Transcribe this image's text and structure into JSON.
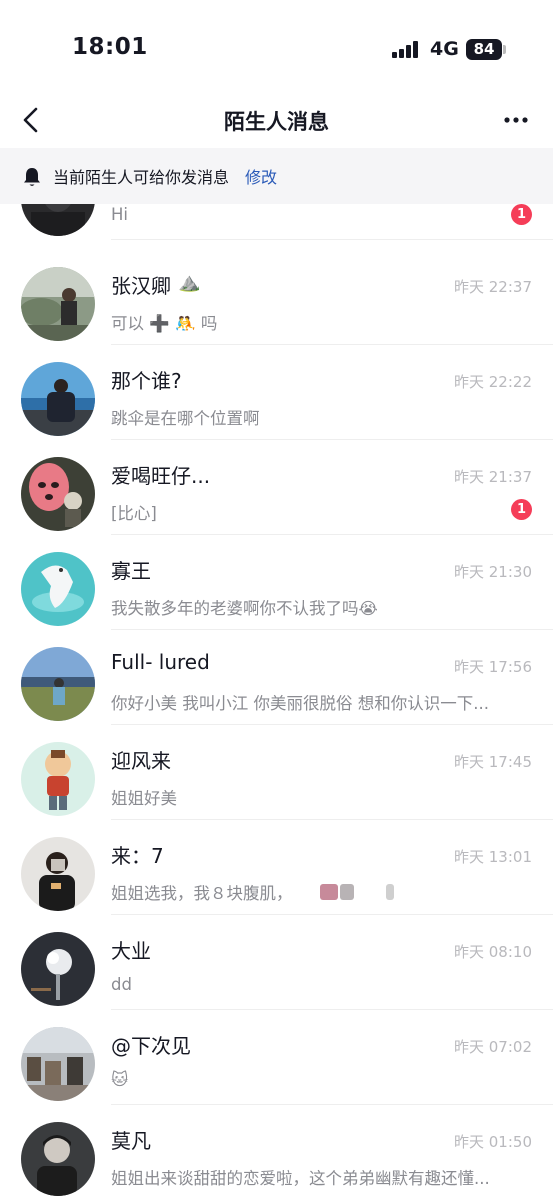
{
  "status_bar": {
    "time": "18:01",
    "network": "4G",
    "battery": "84"
  },
  "nav": {
    "title": "陌生人消息",
    "back_icon": "chevron-left-icon",
    "more_icon": "more-dots-icon"
  },
  "notice": {
    "text": "当前陌生人可给你发消息",
    "link": "修改",
    "icon": "bell-icon"
  },
  "conversations": [
    {
      "name": "",
      "message": "Hi",
      "time": "",
      "unread": "1"
    },
    {
      "name": "张汉卿",
      "name_suffix": "⛰️",
      "message": "可以 ➕ 🤼 吗",
      "time": "昨天 22:37",
      "unread": ""
    },
    {
      "name": "那个谁?",
      "message": "跳伞是在哪个位置啊",
      "time": "昨天 22:22",
      "unread": ""
    },
    {
      "name": "爱喝旺仔...",
      "message": "[比心]",
      "time": "昨天 21:37",
      "unread": "1"
    },
    {
      "name": "寡王",
      "message": "我失散多年的老婆啊你不认我了吗😭",
      "time": "昨天 21:30",
      "unread": ""
    },
    {
      "name": "Full- lured",
      "message": "你好小美 我叫小江 你美丽很脱俗 想和你认识一下...",
      "time": "昨天 17:56",
      "unread": ""
    },
    {
      "name": "迎风来",
      "message": "姐姐好美",
      "time": "昨天 17:45",
      "unread": ""
    },
    {
      "name": "来：7",
      "message": "姐姐选我，我８块腹肌，",
      "time": "昨天 13:01",
      "unread": ""
    },
    {
      "name": "大业",
      "message": "dd",
      "time": "昨天 08:10",
      "unread": ""
    },
    {
      "name": "@下次见",
      "message": "🐱",
      "time": "昨天 07:02",
      "unread": ""
    },
    {
      "name": "莫凡",
      "message": "姐姐出来谈甜甜的恋爱啦，这个弟弟幽默有趣还懂...",
      "time": "昨天 01:50",
      "unread": ""
    }
  ],
  "colors": {
    "badge": "#f53d58",
    "link": "#2b5bb8",
    "muted": "#8a8b91",
    "time": "#b9b9bd"
  }
}
